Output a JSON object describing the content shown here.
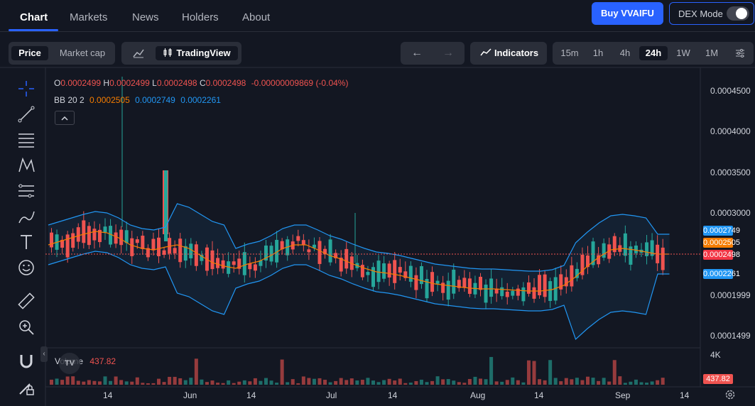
{
  "nav": {
    "tabs": [
      {
        "label": "Chart",
        "active": true
      },
      {
        "label": "Markets",
        "active": false
      },
      {
        "label": "News",
        "active": false
      },
      {
        "label": "Holders",
        "active": false
      },
      {
        "label": "About",
        "active": false
      }
    ],
    "buy_label": "Buy VVAIFU",
    "dex_label": "DEX Mode",
    "dex_enabled": true
  },
  "toolbar": {
    "price_label": "Price",
    "mcap_label": "Market cap",
    "tradingview_label": "TradingView",
    "indicators_label": "Indicators",
    "intervals": [
      "15m",
      "1h",
      "4h",
      "24h",
      "1W",
      "1M"
    ],
    "active_interval": "24h"
  },
  "legend": {
    "o_label": "O",
    "o": "0.0002499",
    "h_label": "H",
    "h": "0.0002499",
    "l_label": "L",
    "l": "0.0002498",
    "c_label": "C",
    "c": "0.0002498",
    "change": "-0.00000009869 (-0.04%)",
    "bb_label": "BB 20 2",
    "bb_mid": "0.0002505",
    "bb_upper": "0.0002749",
    "bb_lower": "0.0002261",
    "volume_label": "Volume",
    "volume": "437.82"
  },
  "price_axis": {
    "ticks": [
      "0.0004500",
      "0.0004000",
      "0.0003500",
      "0.0003000",
      "0.0001999",
      "0.0001499"
    ],
    "tags": [
      {
        "text": "0.0002749",
        "color": "#2196f3"
      },
      {
        "text": "0.0002505",
        "color": "#f57c00"
      },
      {
        "text": "0.0002498",
        "color": "#f23645"
      },
      {
        "text": "0.0002261",
        "color": "#2196f3"
      }
    ],
    "volume_tick": "4K",
    "volume_tag": "437.82"
  },
  "time_axis": [
    "14",
    "Jun",
    "14",
    "Jul",
    "14",
    "Aug",
    "14",
    "Sep",
    "14"
  ],
  "colors": {
    "up": "#26a69a",
    "down": "#ef5350",
    "bb_band": "#2196f3",
    "bb_basis": "#f57c00",
    "accent": "#2962ff"
  },
  "icons": [
    "crosshair-icon",
    "trend-line-icon",
    "fib-icon",
    "pattern-icon",
    "measure-icon",
    "brush-icon",
    "text-icon",
    "emoji-icon",
    "ruler-icon",
    "zoom-in-icon",
    "magnet-icon",
    "lock-pen-icon"
  ]
}
